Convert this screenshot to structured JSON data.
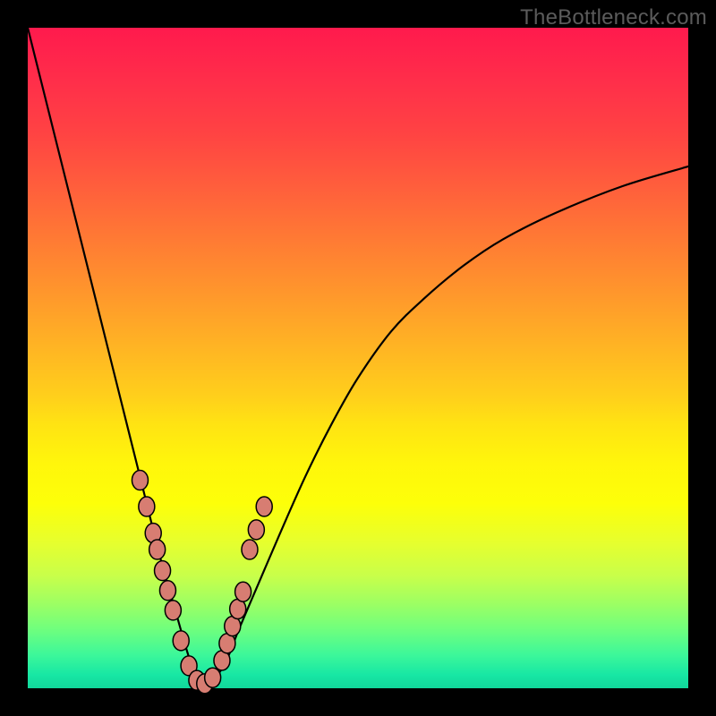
{
  "watermark": "TheBottleneck.com",
  "chart_data": {
    "type": "line",
    "title": "",
    "xlabel": "",
    "ylabel": "",
    "xlim": [
      0,
      100
    ],
    "ylim": [
      0,
      100
    ],
    "grid": false,
    "legend": false,
    "series": [
      {
        "name": "bottleneck-curve",
        "x": [
          0,
          2,
          4,
          6,
          8,
          10,
          12,
          14,
          16,
          18,
          20,
          22,
          24,
          25,
          26,
          27,
          28,
          30,
          32,
          35,
          38,
          42,
          46,
          50,
          55,
          60,
          66,
          72,
          80,
          90,
          100
        ],
        "values": [
          100,
          92,
          84,
          76,
          68,
          60,
          52,
          44,
          36,
          28,
          20,
          13,
          6,
          3,
          1,
          0,
          1,
          4,
          9,
          16,
          23,
          32,
          40,
          47,
          54,
          59,
          64,
          68,
          72,
          76,
          79
        ]
      }
    ],
    "markers": {
      "name": "highlight-dots",
      "x": [
        17.0,
        18.0,
        19.0,
        19.6,
        20.4,
        21.2,
        22.0,
        23.2,
        24.4,
        25.6,
        26.8,
        28.0,
        29.4,
        30.2,
        31.0,
        31.8,
        32.6,
        33.6,
        34.6,
        35.8
      ],
      "values": [
        31.5,
        27.5,
        23.5,
        21.0,
        17.8,
        14.8,
        11.8,
        7.2,
        3.4,
        1.2,
        0.7,
        1.6,
        4.2,
        6.8,
        9.4,
        12.0,
        14.6,
        21.0,
        24.0,
        27.5
      ]
    }
  }
}
